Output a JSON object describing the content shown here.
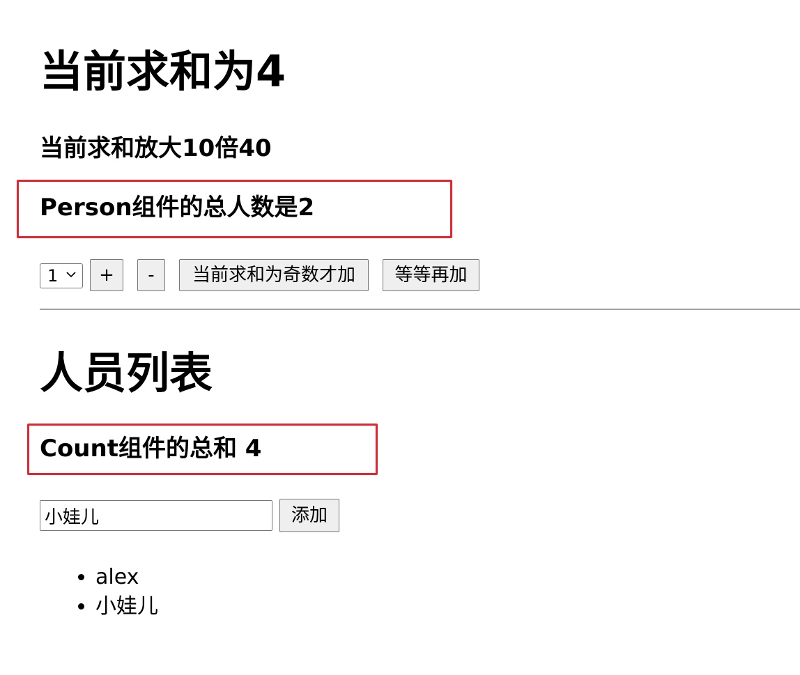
{
  "count": {
    "sum_heading": "当前求和为4",
    "sum_x10": "当前求和放大10倍40",
    "person_total": "Person组件的总人数是2",
    "select_value": "1",
    "buttons": {
      "increment": "+",
      "decrement": "-",
      "increment_if_odd": "当前求和为奇数才加",
      "increment_async": "等等再加"
    },
    "highlight_color": "#e8232d"
  },
  "person": {
    "heading": "人员列表",
    "count_total": "Count组件的总和 4",
    "input_value": "小娃儿",
    "add_button": "添加",
    "items": [
      "alex",
      "小娃儿"
    ]
  }
}
